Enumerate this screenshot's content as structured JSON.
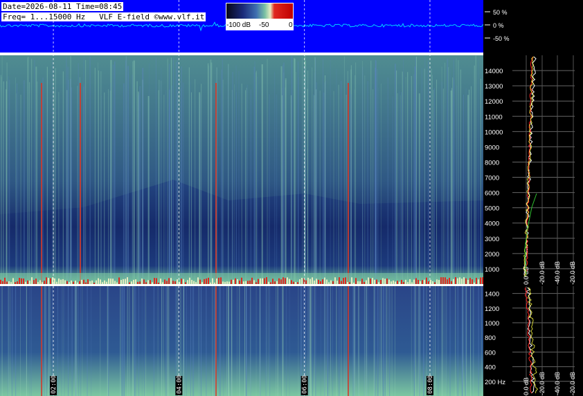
{
  "header": {
    "date_label": "Date=2026-08-11",
    "time_label": "Time=08:45",
    "freq_label": "Freq= 1...15000 Hz",
    "station_label": "VLF E-field ©www.vlf.it"
  },
  "colorbar": {
    "ticks": [
      "-100 dB",
      "-50",
      "0"
    ],
    "colors": [
      "#06071a",
      "#1b2a7a",
      "#3f6fb0",
      "#7cc2a4",
      "#e6ecc0",
      "#e02820",
      "#c00000"
    ]
  },
  "colors": {
    "waveform_bg": "#0000ff",
    "waveform_line": "#00d4ff",
    "spec_bg": "#1a2f78",
    "noise_band": "#6fbf9a",
    "hot_line": "#d23a2a",
    "panel_text": "#ffffff"
  },
  "waveform": {
    "ticks": [
      "50 %",
      "0 %",
      "-50 %"
    ]
  },
  "spectrogram_top": {
    "freq_ticks": [
      "1000",
      "2000",
      "3000",
      "4000",
      "5000",
      "6000",
      "7000",
      "8000",
      "9000",
      "10000",
      "11000",
      "12000",
      "13000",
      "14000"
    ],
    "freq_values": [
      1000,
      2000,
      3000,
      4000,
      5000,
      6000,
      7000,
      8000,
      9000,
      10000,
      11000,
      12000,
      13000,
      14000
    ],
    "freq_range": [
      0,
      15000
    ]
  },
  "spectrogram_bottom": {
    "freq_ticks": [
      "200 Hz",
      "400",
      "600",
      "800",
      "1000",
      "1200",
      "1400"
    ],
    "freq_values": [
      200,
      400,
      600,
      800,
      1000,
      1200,
      1400
    ],
    "freq_range": [
      0,
      1500
    ]
  },
  "time_axis": {
    "labels": [
      "02:00",
      "04:00",
      "06:00",
      "08:00"
    ],
    "hours": [
      2,
      4,
      6,
      8
    ],
    "range_hours": [
      1.15,
      8.85
    ]
  },
  "db_axis": {
    "labels": [
      "0.0 dB",
      "-20.0 dB",
      "-40.0 dB",
      "-20.0 dB"
    ]
  },
  "chart_data": {
    "type": "heatmap",
    "title": "",
    "xlabel": "",
    "ylabel": "",
    "x_ticks": [
      "02:00",
      "04:00",
      "06:00",
      "08:00"
    ],
    "y_range_top_hz": [
      0,
      15000
    ],
    "y_range_bottom_hz": [
      0,
      1500
    ],
    "colorbar_range_db": [
      -100,
      0
    ]
  }
}
